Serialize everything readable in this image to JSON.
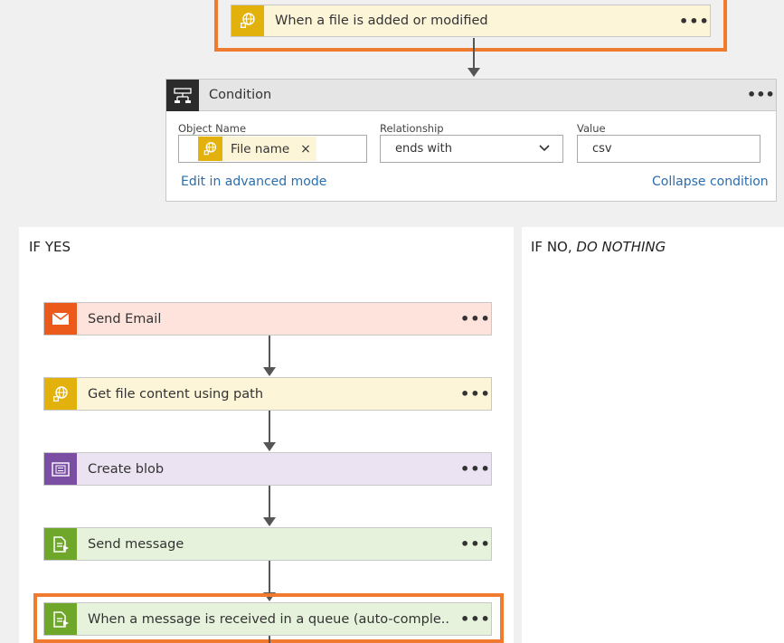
{
  "trigger": {
    "label": "When a file is added or modified",
    "menu": "•••",
    "icon": "ftp-globe-icon",
    "color": "#e3b10c"
  },
  "condition": {
    "title": "Condition",
    "menu": "•••",
    "icon": "condition-icon",
    "object_name_label": "Object Name",
    "object_token": "File name",
    "object_token_remove": "×",
    "relationship_label": "Relationship",
    "relationship_value": "ends with",
    "value_label": "Value",
    "value_value": "csv",
    "edit_link": "Edit in advanced mode",
    "collapse_link": "Collapse condition"
  },
  "if_yes": {
    "title": "IF YES",
    "actions": [
      {
        "label": "Send Email",
        "icon": "mail-icon",
        "color": "#eb5a1a",
        "bg": "#fde3dc"
      },
      {
        "label": "Get file content using path",
        "icon": "ftp-globe-icon",
        "color": "#e3b10c",
        "bg": "#fdf5d8"
      },
      {
        "label": "Create blob",
        "icon": "blob-storage-icon",
        "color": "#7a4ea3",
        "bg": "#ebe3f1"
      },
      {
        "label": "Send message",
        "icon": "service-bus-icon",
        "color": "#6fa72a",
        "bg": "#e6f2db"
      },
      {
        "label": "When a message is received in a queue (auto-comple..",
        "icon": "service-bus-icon",
        "color": "#6fa72a",
        "bg": "#e6f2db"
      }
    ],
    "menu": "•••"
  },
  "if_no": {
    "title_prefix": "IF NO, ",
    "title_emph": "DO NOTHING"
  },
  "colors": {
    "highlight": "#f07a2e",
    "link": "#2a6ead"
  }
}
